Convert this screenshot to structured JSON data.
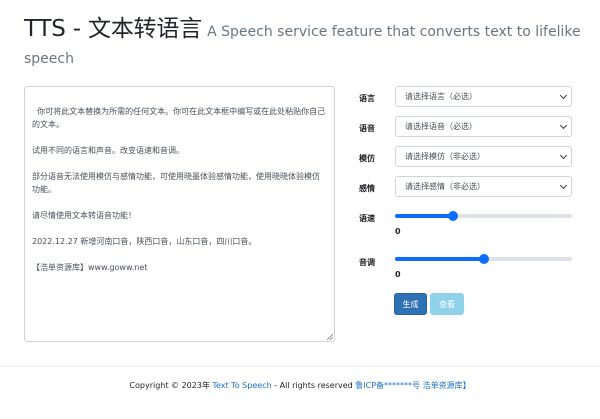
{
  "header": {
    "title": "TTS - 文本转语言",
    "subtitle": "A Speech service feature that converts text to lifelike speech"
  },
  "editor": {
    "text": "你可将此文本替换为所需的任何文本。你可在此文本框中编写或在此处粘贴你自己的文本。\n\n试用不同的语言和声音。改变语速和音调。\n\n部分语音无法使用模仿与感情功能，可使用晓墨体验感情功能，使用晓晓体验模仿功能。\n\n请尽情使用文本转语音功能！\n\n2022.12.27 新增河南口音，陕西口音，山东口音，四川口音。\n\n【浩单资源库】www.goww.net"
  },
  "form": {
    "language": {
      "label": "语言",
      "value": "请选择语言（必选）"
    },
    "voice": {
      "label": "语音",
      "value": "请选择语音（必选）"
    },
    "imitate": {
      "label": "模仿",
      "value": "请选择模仿（非必选）"
    },
    "emotion": {
      "label": "感情",
      "value": "请选择感情（非必选）"
    },
    "rate": {
      "label": "语速",
      "value": "0",
      "position_fraction": 0.33
    },
    "pitch": {
      "label": "音调",
      "value": "0",
      "position_fraction": 0.5
    }
  },
  "buttons": {
    "generate": "生成",
    "view": "查看"
  },
  "footer": {
    "copyright": "Copyright © 2023年 ",
    "app_link": "Text To Speech",
    "rights": " - All rights reserved ",
    "icp_link": "鲁ICP备*******号 浩单资源库】"
  },
  "colors": {
    "primary": "#2f71b5",
    "info": "#8fd2ea",
    "slider": "#0d6efd",
    "link": "#1a6fc9"
  }
}
